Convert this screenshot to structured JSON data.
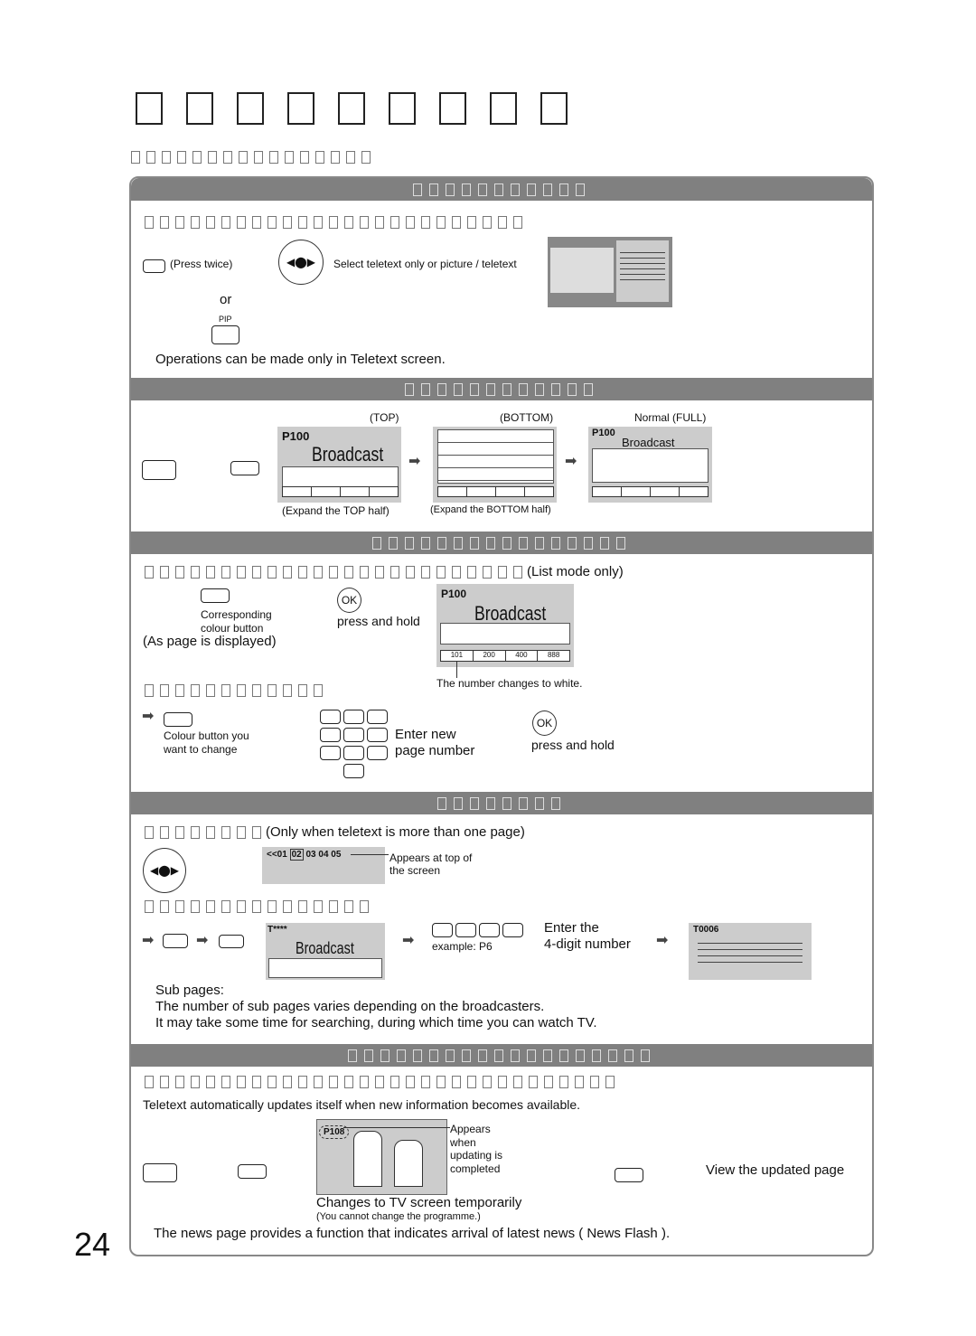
{
  "page_number": "24",
  "section1": {
    "press_twice": "(Press twice)",
    "select_text": "Select teletext only or picture / teletext",
    "or": "or",
    "pip": "PIP",
    "operations_note": "Operations can be made only in Teletext screen."
  },
  "section2": {
    "top": "(TOP)",
    "bottom": "(BOTTOM)",
    "normal": "Normal (FULL)",
    "p100": "P100",
    "broadcast": "Broadcast",
    "expand_top": "(Expand the TOP half)",
    "expand_bottom": "(Expand the BOTTOM half)"
  },
  "section3": {
    "list_mode": "(List mode only)",
    "corresponding": "Corresponding",
    "colour_button": "colour button",
    "as_page": "(As page is displayed)",
    "ok": "OK",
    "press_hold": "press and hold",
    "p100": "P100",
    "broadcast": "Broadcast",
    "cells": [
      "101",
      "200",
      "400",
      "888"
    ],
    "number_white": "The number changes to white.",
    "colour_change_1": "Colour button you",
    "colour_change_2": "want to change",
    "enter_new": "Enter new",
    "page_number": "page number",
    "ok2": "OK",
    "press_hold2": "press and hold"
  },
  "section4": {
    "only_when": "(Only when teletext is more than one page)",
    "subpage_bar": "<<01",
    "subpage_sel": "02",
    "subpage_rest": "03 04 05",
    "appears_1": "Appears at top of",
    "appears_2": "the screen",
    "tstars": "T****",
    "broadcast": "Broadcast",
    "example": "example: P6",
    "enter_the": "Enter the",
    "four_digit": "4-digit number",
    "t0006": "T0006",
    "sub_pages": "Sub pages:",
    "sub_note1": "The number of sub pages varies depending on the broadcasters.",
    "sub_note2": "It may take some time for searching, during which time you can watch TV."
  },
  "section5": {
    "auto_update": "Teletext automatically updates itself when new information becomes available.",
    "p108": "P108",
    "appears": [
      "Appears",
      "when",
      "updating is",
      "completed"
    ],
    "view_updated": "View the updated page",
    "changes_tv": "Changes to TV screen temporarily",
    "cannot_change": "(You cannot change the programme.)",
    "news_flash": "The news page provides a function that indicates arrival of latest news ( News Flash )."
  },
  "colors": {
    "header_bar": "#808080",
    "screen_bg": "#cccccc"
  }
}
